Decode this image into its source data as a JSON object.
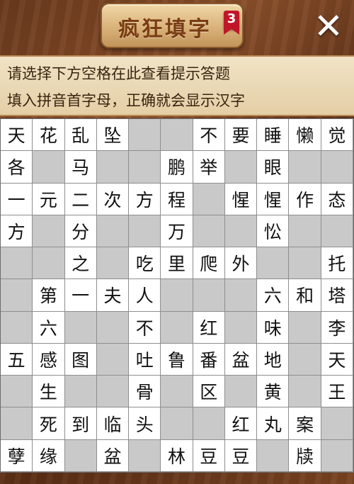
{
  "header": {
    "title": "疯狂填字",
    "level": "3",
    "close_label": "✕"
  },
  "hints": {
    "line1": "请选择下方空格在此查看提示答题",
    "line2": "填入拼音首字母，正确就会显示汉字"
  },
  "grid": {
    "rows": [
      [
        "天",
        "花",
        "乱",
        "坠",
        null,
        null,
        "不",
        "要",
        "睡",
        "懒",
        "觉"
      ],
      [
        "各",
        null,
        "马",
        null,
        null,
        "鹏",
        "举",
        null,
        "眼",
        null,
        null
      ],
      [
        "一",
        "元",
        "二",
        "次",
        "方",
        "程",
        null,
        "惺",
        "惺",
        "作",
        "态"
      ],
      [
        "方",
        null,
        "分",
        null,
        null,
        "万",
        null,
        null,
        "忪",
        null,
        null
      ],
      [
        null,
        null,
        "之",
        null,
        "吃",
        "里",
        "爬",
        "外",
        null,
        null,
        "托"
      ],
      [
        null,
        "第",
        "一",
        "夫",
        "人",
        null,
        null,
        null,
        "六",
        "和",
        "塔"
      ],
      [
        null,
        "六",
        null,
        null,
        "不",
        null,
        "红",
        null,
        "味",
        null,
        "李"
      ],
      [
        "五",
        "感",
        "图",
        null,
        "吐",
        "鲁",
        "番",
        "盆",
        "地",
        null,
        "天"
      ],
      [
        null,
        "生",
        null,
        null,
        "骨",
        null,
        "区",
        null,
        "黄",
        null,
        "王"
      ],
      [
        null,
        "死",
        "到",
        "临",
        "头",
        null,
        null,
        "红",
        "丸",
        "案",
        null
      ],
      [
        "孽",
        "缘",
        null,
        "盆",
        null,
        "林",
        "豆",
        "豆",
        null,
        "牍",
        null
      ]
    ]
  }
}
